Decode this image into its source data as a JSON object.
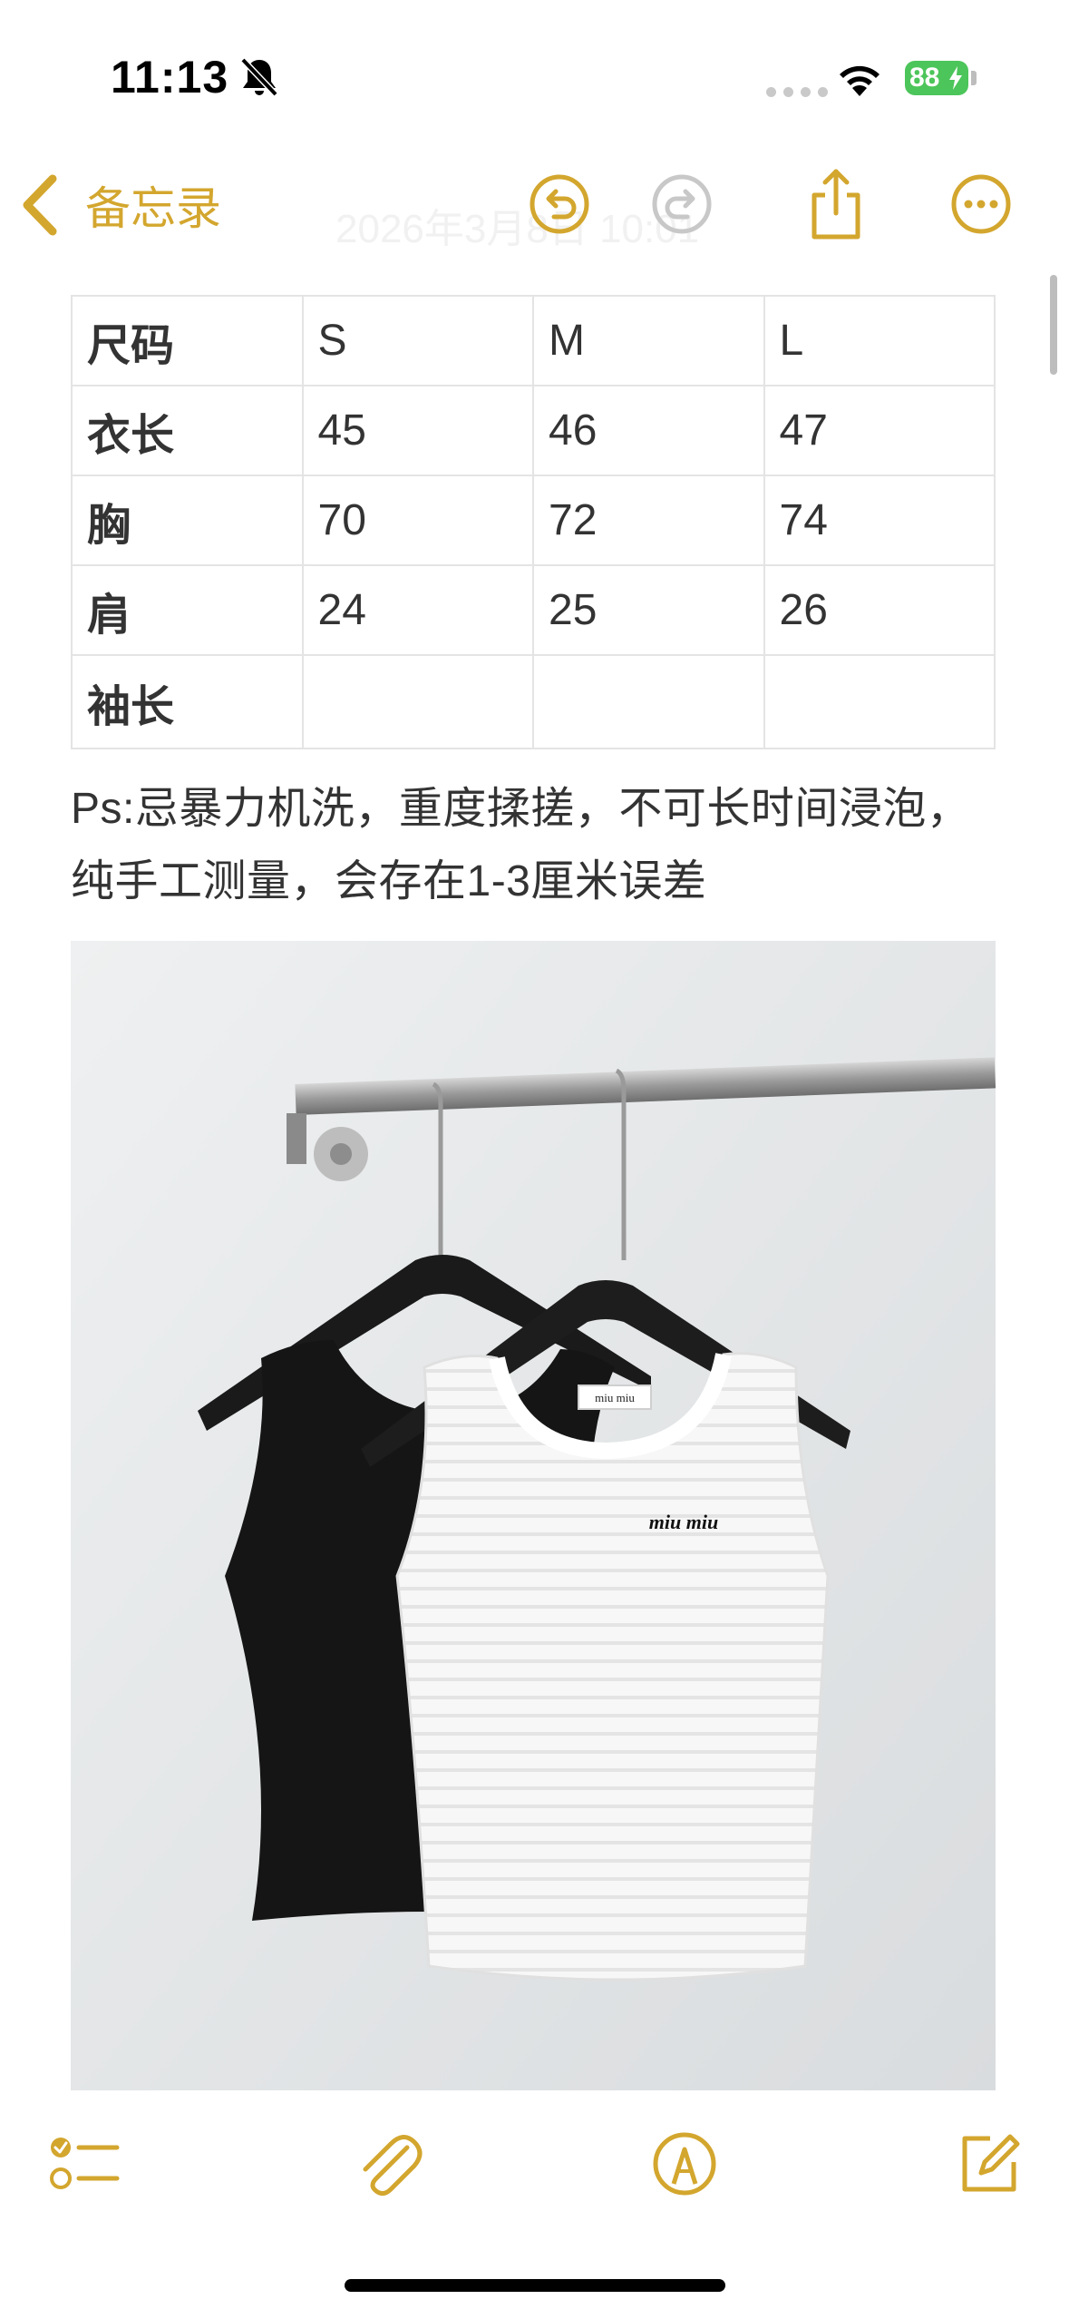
{
  "status_bar": {
    "time": "11:13",
    "battery": "88"
  },
  "nav": {
    "back_label": "备忘录",
    "date": "2026年3月8日 10:01"
  },
  "size_table": {
    "headers": [
      "尺码",
      "S",
      "M",
      "L"
    ],
    "rows": [
      [
        "衣长",
        "45",
        "46",
        "47"
      ],
      [
        "胸",
        "70",
        "72",
        "74"
      ],
      [
        "肩",
        "24",
        "25",
        "26"
      ],
      [
        "袖长",
        "",
        "",
        ""
      ]
    ]
  },
  "note": {
    "line1": "Ps:忌暴力机洗，重度揉搓，不可长时间浸泡，",
    "line2": "纯手工测量，会存在1-3厘米误差"
  },
  "photo": {
    "label_text": "miu miu",
    "logo_text": "miu miu"
  },
  "colors": {
    "accent": "#d3a62e",
    "battery": "#4cc55a",
    "disabled": "#c8c8c8"
  },
  "icons": {
    "undo": "undo-icon",
    "redo": "redo-icon",
    "share": "share-icon",
    "more": "more-icon",
    "checklist": "checklist-icon",
    "attachment": "paperclip-icon",
    "markup": "markup-pen-icon",
    "compose": "compose-icon"
  }
}
